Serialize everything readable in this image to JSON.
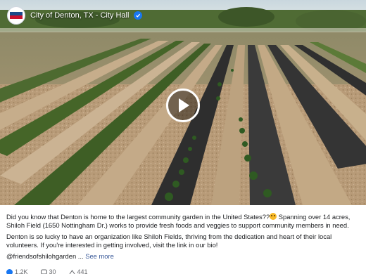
{
  "post": {
    "page_name": "City of Denton, TX - City Hall",
    "avatar_text": "DENTON",
    "caption_line1": "Did you know that Denton is home to the largest community garden in the United States??",
    "caption_line1_cont": " Spanning over 14 acres, Shiloh Field (1650 Nottingham Dr.) works to provide fresh foods and veggies to support community members in need.",
    "caption_line2": "Denton is so lucky to have an organization like Shiloh Fields, thriving from the dedication and heart of their local volunteers. If you're interested in getting involved, visit the link in our bio!",
    "mention": "@friendsofshilohgarden",
    "ellipsis": " ... ",
    "see_more": "See more",
    "reactions_count": "1.2K",
    "comments_count": "30",
    "shares_count": "441"
  },
  "colors": {
    "accent": "#1877f2",
    "link": "#385898"
  },
  "icons": {
    "play": "play-icon",
    "verified": "verified-badge-icon"
  }
}
